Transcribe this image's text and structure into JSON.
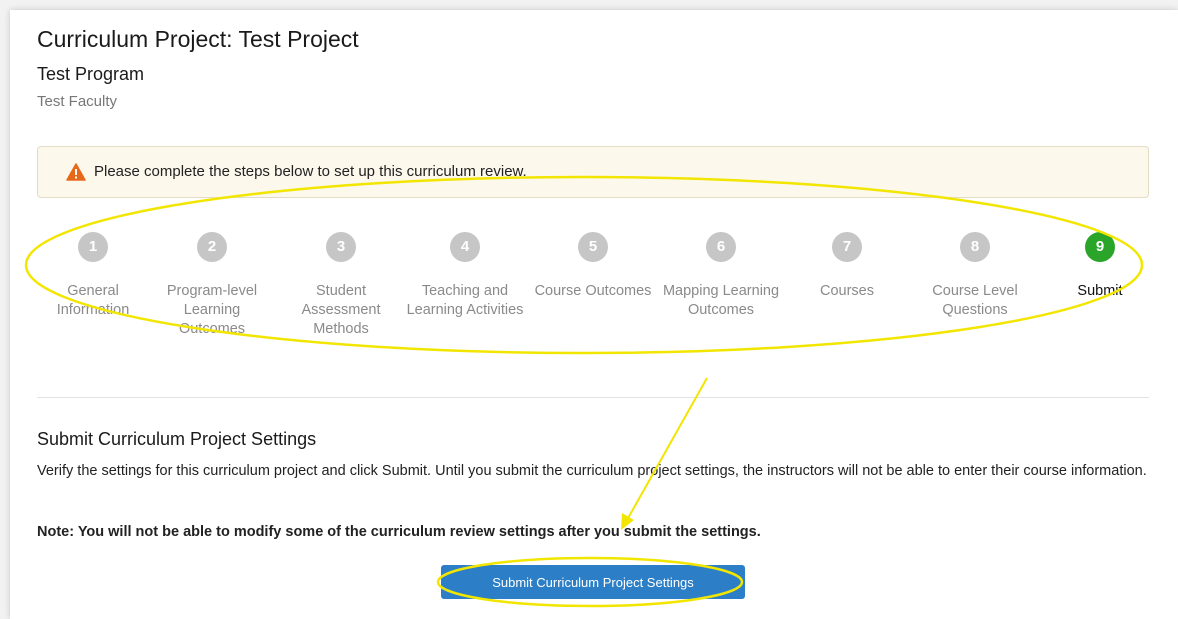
{
  "header": {
    "title": "Curriculum Project: Test Project",
    "program": "Test Program",
    "faculty": "Test Faculty"
  },
  "alert": {
    "icon": "warning-icon",
    "message": "Please complete the steps below to set up this curriculum review.",
    "color": "#e8681a"
  },
  "steps": [
    {
      "number": "1",
      "label": "General Information"
    },
    {
      "number": "2",
      "label": "Program-level Learning Outcomes"
    },
    {
      "number": "3",
      "label": "Student Assessment Methods"
    },
    {
      "number": "4",
      "label": "Teaching and Learning Activities"
    },
    {
      "number": "5",
      "label": "Course Outcomes"
    },
    {
      "number": "6",
      "label": "Mapping Learning Outcomes"
    },
    {
      "number": "7",
      "label": "Courses"
    },
    {
      "number": "8",
      "label": "Course Level Questions"
    },
    {
      "number": "9",
      "label": "Submit",
      "active": true
    }
  ],
  "section": {
    "title": "Submit Curriculum Project Settings",
    "description": "Verify the settings for this curriculum project and click Submit. Until you submit the curriculum project settings, the instructors will not be able to enter their course information.",
    "note": "Note: You will not be able to modify some of the curriculum review settings after you submit the settings.",
    "submit_label": "Submit Curriculum Project Settings"
  },
  "colors": {
    "inactive_step": "#c6c6c6",
    "active_step": "#2aa52a",
    "button": "#2c7fc6",
    "annotation": "#f2e600"
  }
}
